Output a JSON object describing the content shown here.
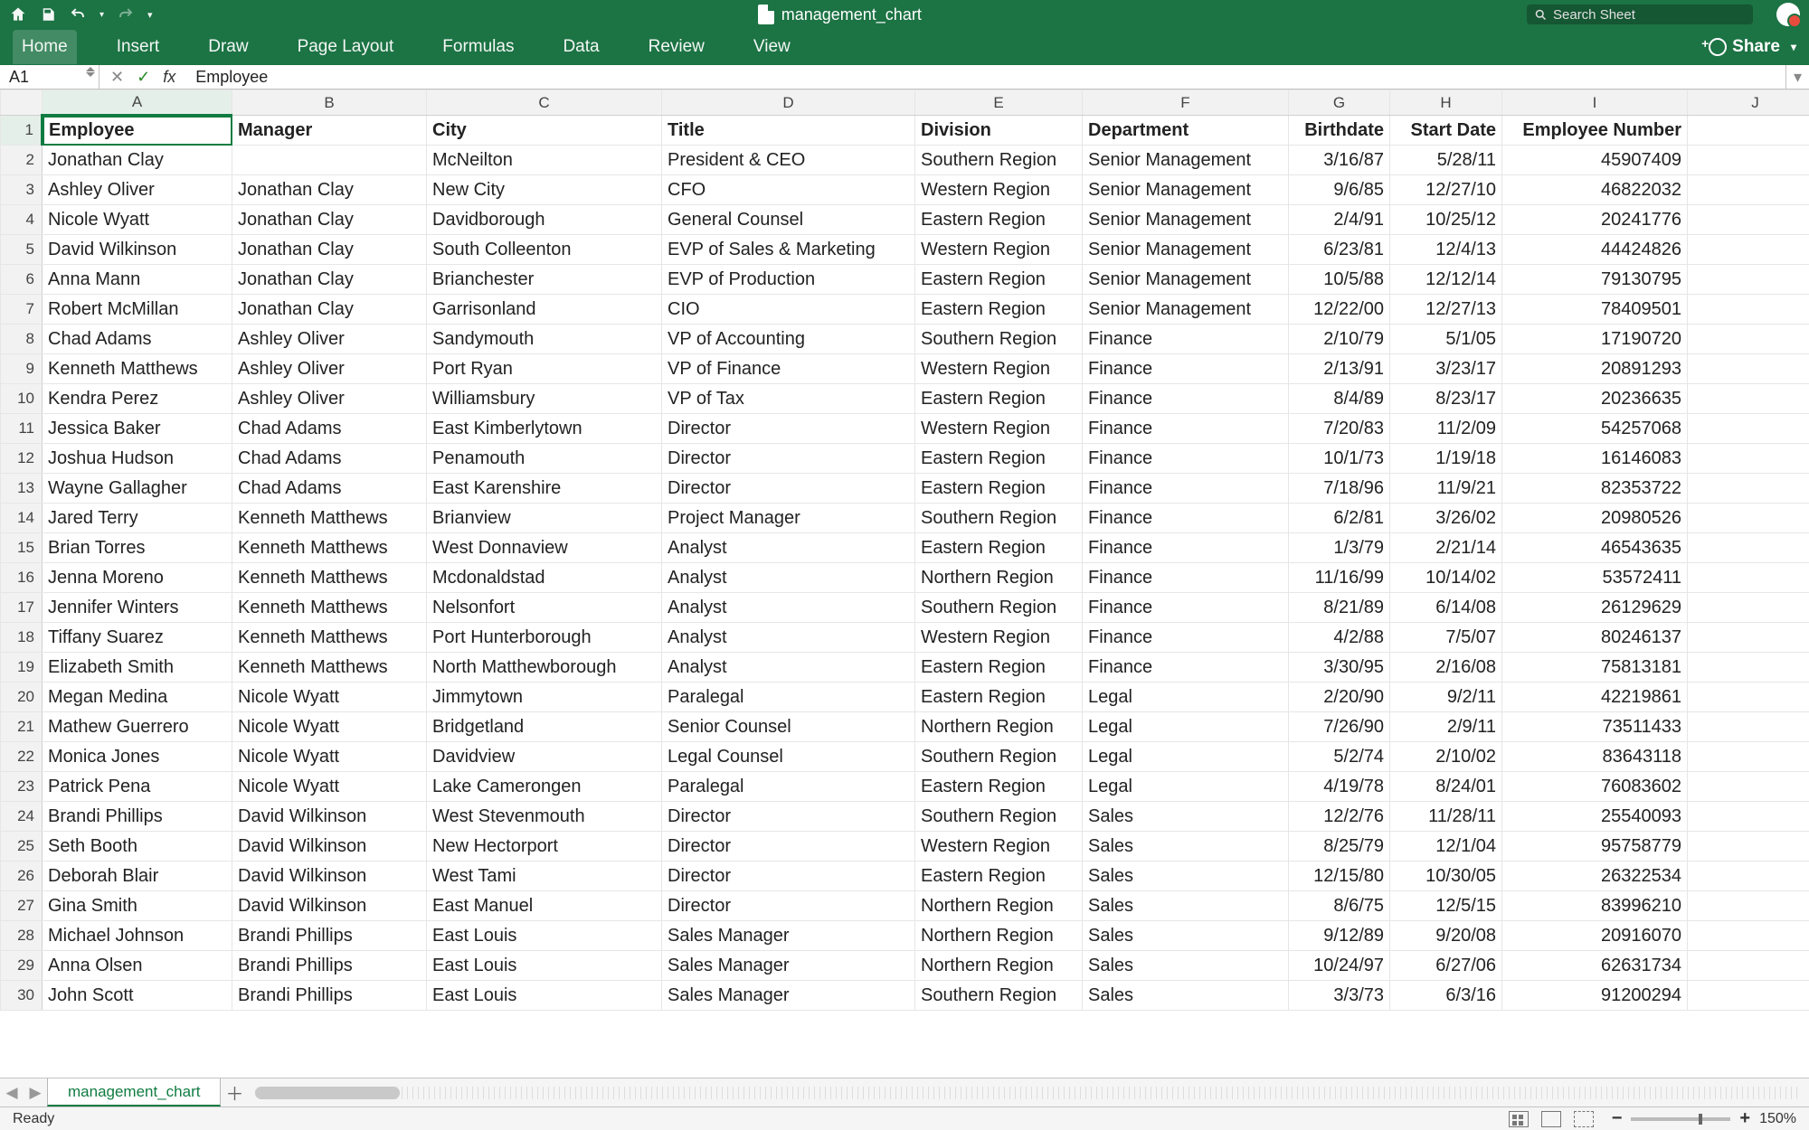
{
  "doc_name": "management_chart",
  "search_placeholder": "Search Sheet",
  "ribbon_tabs": [
    "Home",
    "Insert",
    "Draw",
    "Page Layout",
    "Formulas",
    "Data",
    "Review",
    "View"
  ],
  "share_label": "Share",
  "namebox": "A1",
  "formula": "Employee",
  "col_headers": [
    "A",
    "B",
    "C",
    "D",
    "E",
    "F",
    "G",
    "H",
    "I",
    "J"
  ],
  "header_row": [
    "Employee",
    "Manager",
    "City",
    "Title",
    "Division",
    "Department",
    "Birthdate",
    "Start Date",
    "Employee Number"
  ],
  "rows": [
    [
      "Jonathan Clay",
      "",
      "McNeilton",
      "President & CEO",
      "Southern Region",
      "Senior Management",
      "3/16/87",
      "5/28/11",
      "45907409"
    ],
    [
      "Ashley Oliver",
      "Jonathan Clay",
      "New City",
      "CFO",
      "Western Region",
      "Senior Management",
      "9/6/85",
      "12/27/10",
      "46822032"
    ],
    [
      "Nicole Wyatt",
      "Jonathan Clay",
      "Davidborough",
      "General Counsel",
      "Eastern Region",
      "Senior Management",
      "2/4/91",
      "10/25/12",
      "20241776"
    ],
    [
      "David Wilkinson",
      "Jonathan Clay",
      "South Colleenton",
      "EVP of Sales & Marketing",
      "Western Region",
      "Senior Management",
      "6/23/81",
      "12/4/13",
      "44424826"
    ],
    [
      "Anna Mann",
      "Jonathan Clay",
      "Brianchester",
      "EVP of Production",
      "Eastern Region",
      "Senior Management",
      "10/5/88",
      "12/12/14",
      "79130795"
    ],
    [
      "Robert McMillan",
      "Jonathan Clay",
      "Garrisonland",
      "CIO",
      "Eastern Region",
      "Senior Management",
      "12/22/00",
      "12/27/13",
      "78409501"
    ],
    [
      "Chad Adams",
      "Ashley Oliver",
      "Sandymouth",
      "VP of Accounting",
      "Southern Region",
      "Finance",
      "2/10/79",
      "5/1/05",
      "17190720"
    ],
    [
      "Kenneth Matthews",
      "Ashley Oliver",
      "Port Ryan",
      "VP of Finance",
      "Western Region",
      "Finance",
      "2/13/91",
      "3/23/17",
      "20891293"
    ],
    [
      "Kendra Perez",
      "Ashley Oliver",
      "Williamsbury",
      "VP of Tax",
      "Eastern Region",
      "Finance",
      "8/4/89",
      "8/23/17",
      "20236635"
    ],
    [
      "Jessica Baker",
      "Chad Adams",
      "East Kimberlytown",
      "Director",
      "Western Region",
      "Finance",
      "7/20/83",
      "11/2/09",
      "54257068"
    ],
    [
      "Joshua Hudson",
      "Chad Adams",
      "Penamouth",
      "Director",
      "Eastern Region",
      "Finance",
      "10/1/73",
      "1/19/18",
      "16146083"
    ],
    [
      "Wayne Gallagher",
      "Chad Adams",
      "East Karenshire",
      "Director",
      "Eastern Region",
      "Finance",
      "7/18/96",
      "11/9/21",
      "82353722"
    ],
    [
      "Jared Terry",
      "Kenneth Matthews",
      "Brianview",
      "Project Manager",
      "Southern Region",
      "Finance",
      "6/2/81",
      "3/26/02",
      "20980526"
    ],
    [
      "Brian Torres",
      "Kenneth Matthews",
      "West Donnaview",
      "Analyst",
      "Eastern Region",
      "Finance",
      "1/3/79",
      "2/21/14",
      "46543635"
    ],
    [
      "Jenna Moreno",
      "Kenneth Matthews",
      "Mcdonaldstad",
      "Analyst",
      "Northern Region",
      "Finance",
      "11/16/99",
      "10/14/02",
      "53572411"
    ],
    [
      "Jennifer Winters",
      "Kenneth Matthews",
      "Nelsonfort",
      "Analyst",
      "Southern Region",
      "Finance",
      "8/21/89",
      "6/14/08",
      "26129629"
    ],
    [
      "Tiffany Suarez",
      "Kenneth Matthews",
      "Port Hunterborough",
      "Analyst",
      "Western Region",
      "Finance",
      "4/2/88",
      "7/5/07",
      "80246137"
    ],
    [
      "Elizabeth Smith",
      "Kenneth Matthews",
      "North Matthewborough",
      "Analyst",
      "Eastern Region",
      "Finance",
      "3/30/95",
      "2/16/08",
      "75813181"
    ],
    [
      "Megan Medina",
      "Nicole Wyatt",
      "Jimmytown",
      "Paralegal",
      "Eastern Region",
      "Legal",
      "2/20/90",
      "9/2/11",
      "42219861"
    ],
    [
      "Mathew Guerrero",
      "Nicole Wyatt",
      "Bridgetland",
      "Senior Counsel",
      "Northern Region",
      "Legal",
      "7/26/90",
      "2/9/11",
      "73511433"
    ],
    [
      "Monica Jones",
      "Nicole Wyatt",
      "Davidview",
      "Legal Counsel",
      "Southern Region",
      "Legal",
      "5/2/74",
      "2/10/02",
      "83643118"
    ],
    [
      "Patrick Pena",
      "Nicole Wyatt",
      "Lake Camerongen",
      "Paralegal",
      "Eastern Region",
      "Legal",
      "4/19/78",
      "8/24/01",
      "76083602"
    ],
    [
      "Brandi Phillips",
      "David Wilkinson",
      "West Stevenmouth",
      "Director",
      "Southern Region",
      "Sales",
      "12/2/76",
      "11/28/11",
      "25540093"
    ],
    [
      "Seth Booth",
      "David Wilkinson",
      "New Hectorport",
      "Director",
      "Western Region",
      "Sales",
      "8/25/79",
      "12/1/04",
      "95758779"
    ],
    [
      "Deborah Blair",
      "David Wilkinson",
      "West Tami",
      "Director",
      "Eastern Region",
      "Sales",
      "12/15/80",
      "10/30/05",
      "26322534"
    ],
    [
      "Gina Smith",
      "David Wilkinson",
      "East Manuel",
      "Director",
      "Northern Region",
      "Sales",
      "8/6/75",
      "12/5/15",
      "83996210"
    ],
    [
      "Michael Johnson",
      "Brandi Phillips",
      "East Louis",
      "Sales Manager",
      "Northern Region",
      "Sales",
      "9/12/89",
      "9/20/08",
      "20916070"
    ],
    [
      "Anna Olsen",
      "Brandi Phillips",
      "East Louis",
      "Sales Manager",
      "Northern Region",
      "Sales",
      "10/24/97",
      "6/27/06",
      "62631734"
    ],
    [
      "John Scott",
      "Brandi Phillips",
      "East Louis",
      "Sales Manager",
      "Southern Region",
      "Sales",
      "3/3/73",
      "6/3/16",
      "91200294"
    ]
  ],
  "numeric_cols": [
    6,
    7,
    8
  ],
  "sheet_tab": "management_chart",
  "status_ready": "Ready",
  "zoom": "150%"
}
